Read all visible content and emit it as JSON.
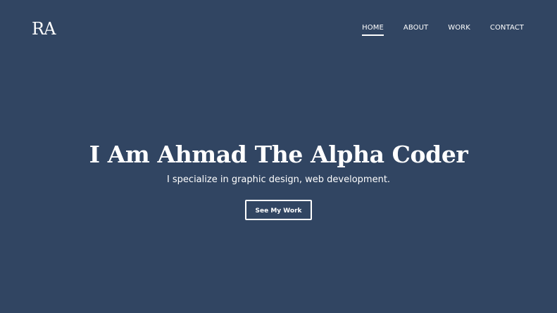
{
  "header": {
    "logo_text": "RA",
    "nav": [
      {
        "label": "HOME",
        "active": true
      },
      {
        "label": "ABOUT",
        "active": false
      },
      {
        "label": "WORK",
        "active": false
      },
      {
        "label": "CONTACT",
        "active": false
      }
    ]
  },
  "hero": {
    "title": "I Am Ahmad The Alpha Coder",
    "subtitle": "I specialize in graphic design, web development.",
    "cta_label": "See My Work"
  },
  "colors": {
    "background": "#314562",
    "text": "#ffffff"
  }
}
